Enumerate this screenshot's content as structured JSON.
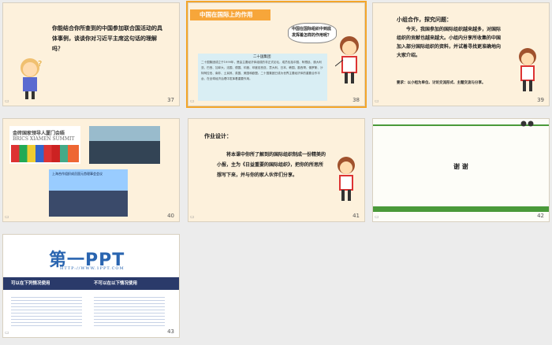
{
  "slides": [
    {
      "num": "37",
      "text": "你能结合你所查到的中国参加联合国活动的具体事例，谈谈你对习近平主席这句话的理解吗？"
    },
    {
      "num": "38",
      "header": "中国在国际上的作用",
      "bubble": "中国在国际组织中到底发挥着怎样的作用呢？",
      "box_title": "二十国集团",
      "box_text": "二十国集团成立于1999年，是由主要经济体组成的非正式论坛，成员包括中国、阿根廷、澳大利亚、巴西、加拿大、法国、德国、印度、印度尼西亚、意大利、日本、韩国、墨西哥、俄罗斯、沙特阿拉伯、南非、土耳其、英国、美国和欧盟。二十国集团已成为世界主要经济体的重要合作平台，在全球经济治理中发挥着重要作用。"
    },
    {
      "num": "39",
      "title": "小组合作，探究问题：",
      "text": "今天，我国参加的国际组织越来越多，对国际组织的贡献也越来越大。小组内分享所收集的中国加入部分国际组织的资料，并试着寻找更准确地向大家介绍。",
      "req": "要求：以小组为单位、讨论交流形式、主题交流与分享。"
    },
    {
      "num": "40",
      "img1_title": "金砖国家领导人厦门会晤",
      "img1_sub": "BRICS XIAMEN SUMMIT",
      "img3_title": "上海合作组织成员国元首理事会会议"
    },
    {
      "num": "41",
      "title": "作业设计：",
      "text": "将本课中你所了解到的国际组织制成一份精美的小报，主为《日益重要的国际组织》，把你的所思所想写下来，并与你的家人伙伴们分享。"
    },
    {
      "num": "42",
      "text": "谢  谢"
    },
    {
      "num": "43",
      "logo": "第一PPT",
      "url": "HTTP://WWW.1PPT.COM",
      "can_title": "可以在下列情况使用",
      "cannot_title": "不可以在以下情况使用"
    }
  ]
}
